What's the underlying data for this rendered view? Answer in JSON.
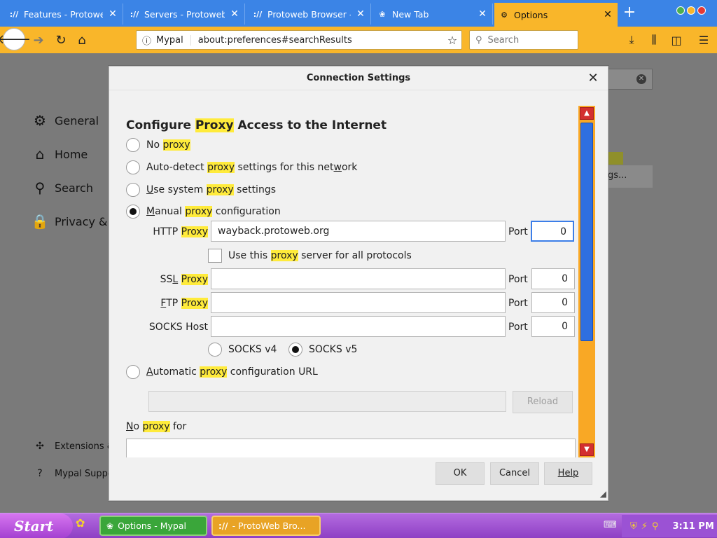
{
  "tabs": [
    {
      "label": "Features - Protoweb",
      "icon": "://",
      "active": false
    },
    {
      "label": "Servers - Protoweb",
      "icon": "://",
      "active": false
    },
    {
      "label": "Protoweb Browser -",
      "icon": "://",
      "active": false
    },
    {
      "label": "New Tab",
      "icon": "bug",
      "active": false
    },
    {
      "label": "Options",
      "icon": "gear",
      "active": true
    }
  ],
  "navbar": {
    "url_identity": "Mypal",
    "url": "about:preferences#searchResults",
    "search_placeholder": "Search"
  },
  "prefs_nav": [
    {
      "label": "General",
      "icon": "gear-icon"
    },
    {
      "label": "Home",
      "icon": "home-icon"
    },
    {
      "label": "Search",
      "icon": "search-icon"
    },
    {
      "label": "Privacy & S",
      "icon": "lock-icon"
    }
  ],
  "prefs_footer": [
    {
      "label": "Extensions &",
      "icon": "puzzle-icon"
    },
    {
      "label": "Mypal Suppo",
      "icon": "help-icon"
    }
  ],
  "bg_row_label": "gs...",
  "dialog": {
    "title": "Connection Settings",
    "heading_pre": "Configure ",
    "heading_hl": "Proxy",
    "heading_post": " Access to the Internet",
    "options": {
      "no_proxy": {
        "a": "N",
        "b": "o ",
        "hl": "proxy",
        "c": ""
      },
      "auto_detect": {
        "a": "Auto-detect ",
        "hl": "proxy",
        "b": " settings for this net",
        "u": "w",
        "c": "ork"
      },
      "system": {
        "u": "U",
        "a": "se system ",
        "hl": "proxy",
        "b": " settings"
      },
      "manual": {
        "u": "M",
        "a": "anual ",
        "hl": "proxy",
        "b": " configuration"
      },
      "auto_url": {
        "a": "",
        "u": "A",
        "b": "utomatic ",
        "hl": "proxy",
        "c": " configuration URL"
      }
    },
    "http": {
      "label": "HTTP ",
      "hl": "Proxy",
      "value": "wayback.protoweb.org",
      "port_label": "Port",
      "port": "0"
    },
    "share": {
      "a": "Use this ",
      "hl": "proxy",
      "b": " server for all protocols"
    },
    "ssl": {
      "label": "SS",
      "u": "L",
      "sp": " ",
      "hl": "Proxy",
      "value": "",
      "port_label": "Port",
      "port": "0"
    },
    "ftp": {
      "u": "F",
      "label": "TP ",
      "hl": "Proxy",
      "value": "",
      "port_label": "Port",
      "port": "0"
    },
    "socks": {
      "label": "SOCKS Host",
      "value": "",
      "port_label": "Port",
      "port": "0"
    },
    "socks_v4": "SOCKS v4",
    "socks_v5": "SOCKS v5",
    "reload_label": "Reload",
    "no_proxy_for": {
      "u": "N",
      "a": "o ",
      "hl": "proxy",
      "b": " for"
    },
    "ok_label": "OK",
    "cancel_label": "Cancel",
    "help_label": "Help"
  },
  "taskbar": {
    "start_label": "Start",
    "items": [
      {
        "label": "Options - Mypal"
      },
      {
        "label": "- ProtoWeb Bro..."
      }
    ],
    "time": "3:11 PM"
  },
  "colors": {
    "tab_strip": "#3b84e6",
    "toolbar": "#f9b62a",
    "highlight": "#ffeb3b",
    "scrollbar_track": "#f9a825",
    "scrollbar_thumb": "#2f6fe0",
    "taskbar": "#9b52d4"
  }
}
